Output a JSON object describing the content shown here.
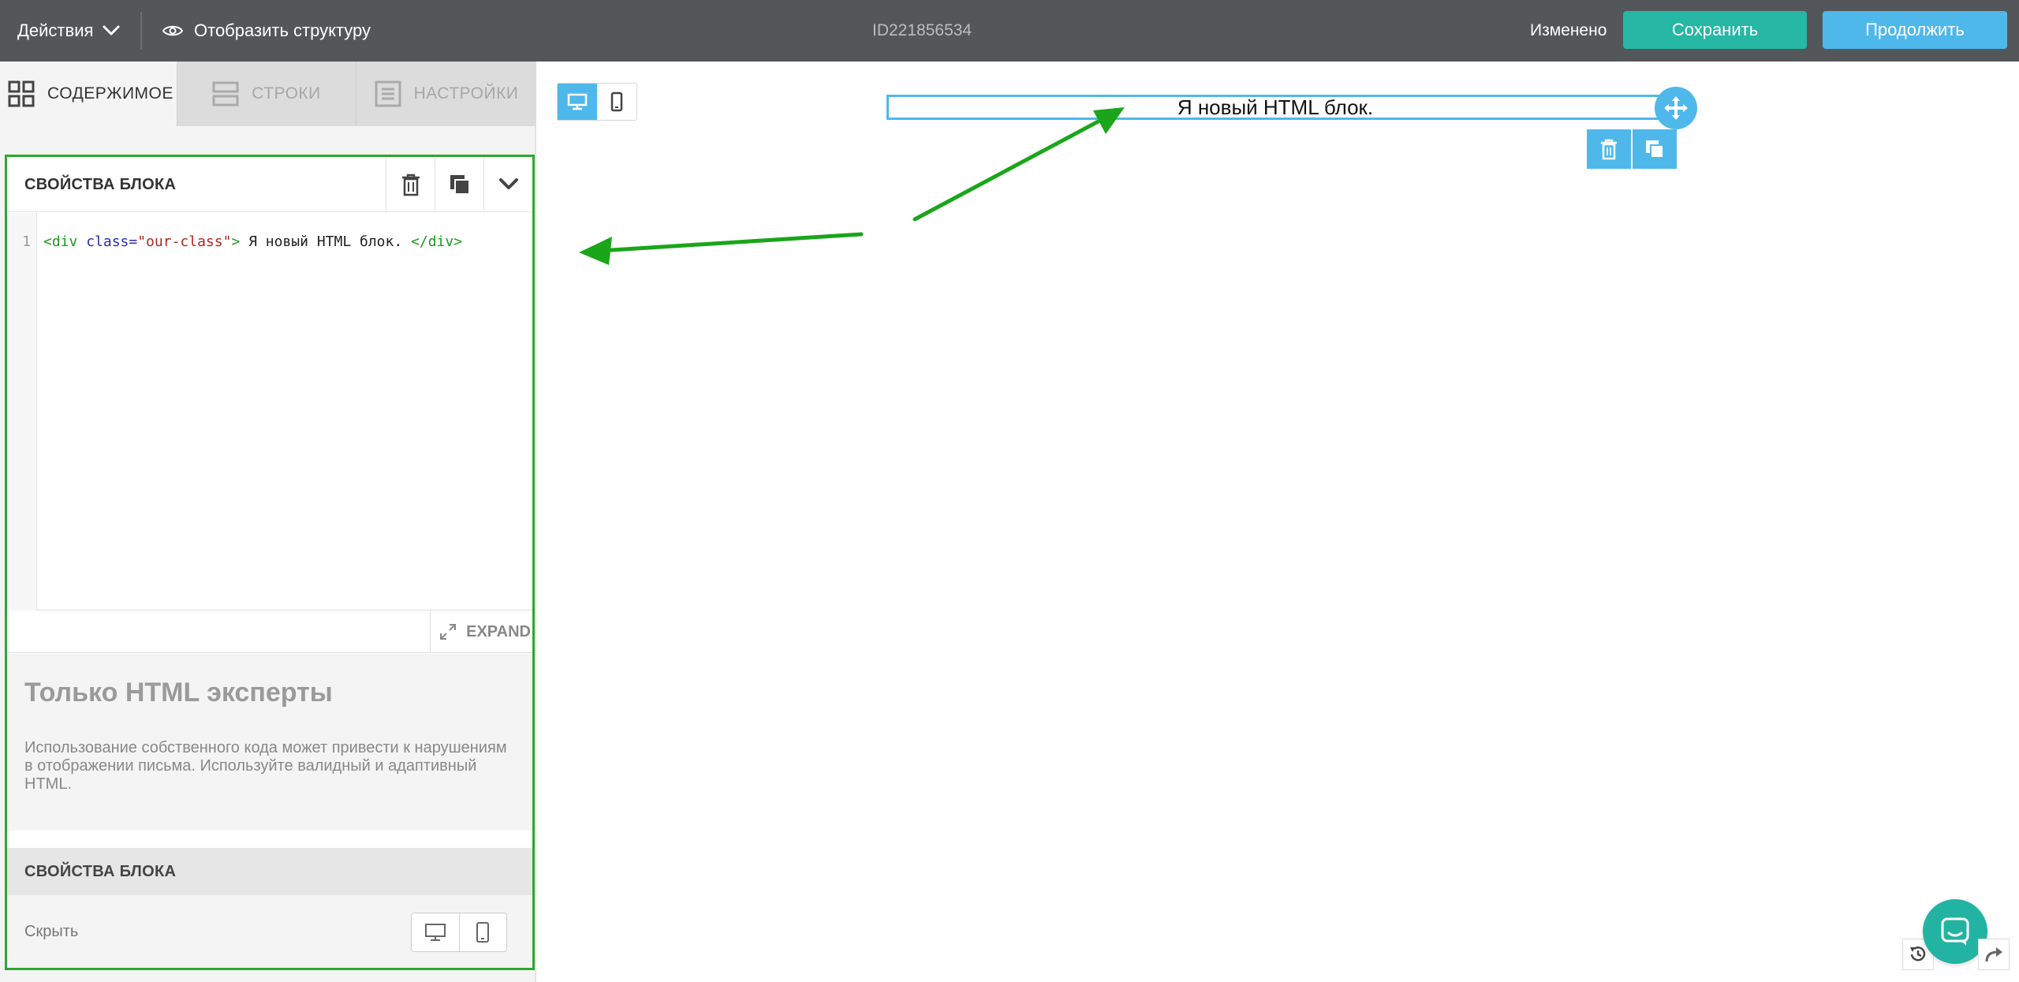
{
  "topbar": {
    "actions_label": "Действия",
    "structure_label": "Отобразить структуру",
    "document_id": "ID221856534",
    "status": "Изменено",
    "save_label": "Сохранить",
    "continue_label": "Продолжить"
  },
  "tabs": [
    {
      "label": "СОДЕРЖИМОЕ",
      "icon": "grid-icon",
      "active": true
    },
    {
      "label": "СТРОКИ",
      "icon": "rows-icon",
      "active": false
    },
    {
      "label": "НАСТРОЙКИ",
      "icon": "settings-list-icon",
      "active": false
    }
  ],
  "block_props": {
    "title": "СВОЙСТВА БЛОКА",
    "header_icons": [
      "trash-icon",
      "duplicate-icon",
      "chevron-down-icon"
    ]
  },
  "editor": {
    "line_number": "1",
    "code": {
      "open_tag": "<div",
      "attr_name": " class=",
      "attr_value": "\"our-class\"",
      "tag_close": ">",
      "text": " Я новый HTML блок. ",
      "close_tag": "</div>"
    }
  },
  "expand": {
    "label": "EXPAND",
    "icon": "expand-icon"
  },
  "warning": {
    "title": "Только HTML эксперты",
    "text": "Использование собственного кода может привести к нарушениям в отображении письма. Используйте валидный и адаптивный HTML."
  },
  "section": {
    "title": "СВОЙСТВА БЛОКА"
  },
  "hide_row": {
    "label": "Скрыть",
    "icons": [
      "desktop-icon",
      "mobile-icon"
    ]
  },
  "canvas": {
    "view_modes": [
      "desktop-icon",
      "mobile-icon"
    ],
    "active_view": "desktop",
    "block_text": "Я новый HTML блок.",
    "block_toolbar_icons": [
      "trash-icon",
      "duplicate-icon"
    ]
  },
  "colors": {
    "topbar_bg": "#53575a",
    "save_bg": "#26b7a5",
    "continue_bg": "#4fb8ea",
    "accent_blue": "#4fb8ea",
    "highlight_green": "#2ea82e",
    "chat_bg": "#23b3a3"
  }
}
